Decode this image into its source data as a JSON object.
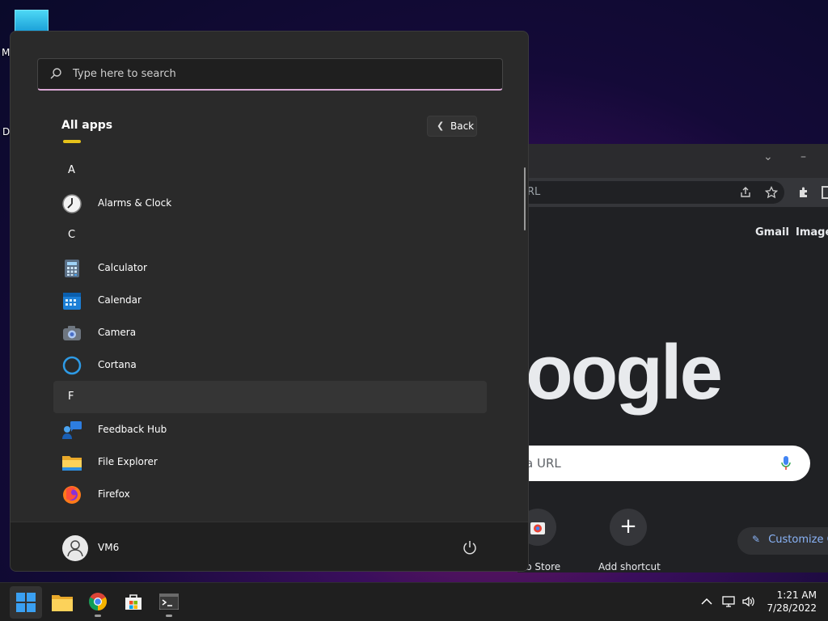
{
  "desktop": {
    "label_1": "M",
    "label_2": "Da"
  },
  "chrome": {
    "omnibox_text": "RL",
    "links": [
      "Gmail",
      "Images"
    ],
    "logo": "oogle",
    "search_placeholder": "a URL",
    "shortcuts": [
      {
        "label": "b Store"
      },
      {
        "label": "Add shortcut",
        "symbol": "+"
      }
    ],
    "customize_label": "Customize C"
  },
  "start_menu": {
    "search_placeholder": "Type here to search",
    "heading": "All apps",
    "back_label": "Back",
    "groups": [
      {
        "letter": "A",
        "apps": [
          {
            "name": "Alarms & Clock",
            "icon": "alarm-clock-icon"
          }
        ]
      },
      {
        "letter": "C",
        "apps": [
          {
            "name": "Calculator",
            "icon": "calculator-icon"
          },
          {
            "name": "Calendar",
            "icon": "calendar-icon"
          },
          {
            "name": "Camera",
            "icon": "camera-icon"
          },
          {
            "name": "Cortana",
            "icon": "cortana-icon"
          }
        ]
      },
      {
        "letter": "F",
        "apps": [
          {
            "name": "Feedback Hub",
            "icon": "feedback-hub-icon"
          },
          {
            "name": "File Explorer",
            "icon": "folder-icon"
          },
          {
            "name": "Firefox",
            "icon": "firefox-icon"
          }
        ]
      }
    ],
    "user_name": "VM6"
  },
  "taskbar": {
    "apps": [
      {
        "name": "start-button",
        "icon": "windows-logo-icon"
      },
      {
        "name": "file-explorer",
        "icon": "folder-icon"
      },
      {
        "name": "chrome",
        "icon": "chrome-icon"
      },
      {
        "name": "microsoft-store",
        "icon": "store-icon"
      },
      {
        "name": "terminal",
        "icon": "terminal-icon"
      }
    ],
    "time": "1:21 AM",
    "date": "7/28/2022"
  },
  "colors": {
    "accent": "#0078d4",
    "menu_bg": "#2a2a2a",
    "search_underline": "#d9a8d4"
  }
}
